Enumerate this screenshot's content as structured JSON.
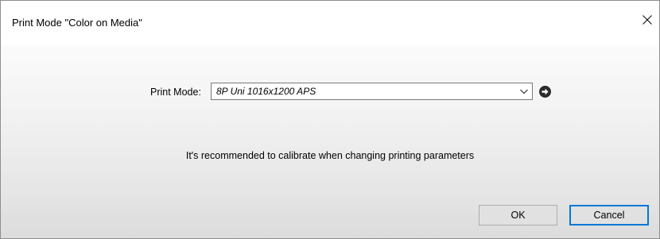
{
  "window": {
    "title": "Print Mode \"Color on Media\"",
    "close_icon": "close-icon"
  },
  "form": {
    "print_mode_label": "Print Mode:",
    "print_mode_value": "8P Uni 1016x1200 APS",
    "dropdown_icon": "chevron-down-icon",
    "go_icon": "arrow-right-circle-icon"
  },
  "message": {
    "text": "It's recommended to calibrate when changing printing parameters"
  },
  "buttons": {
    "ok_label": "OK",
    "cancel_label": "Cancel"
  },
  "colors": {
    "accent_focus": "#0078d7",
    "button_face": "#e1e1e1"
  }
}
